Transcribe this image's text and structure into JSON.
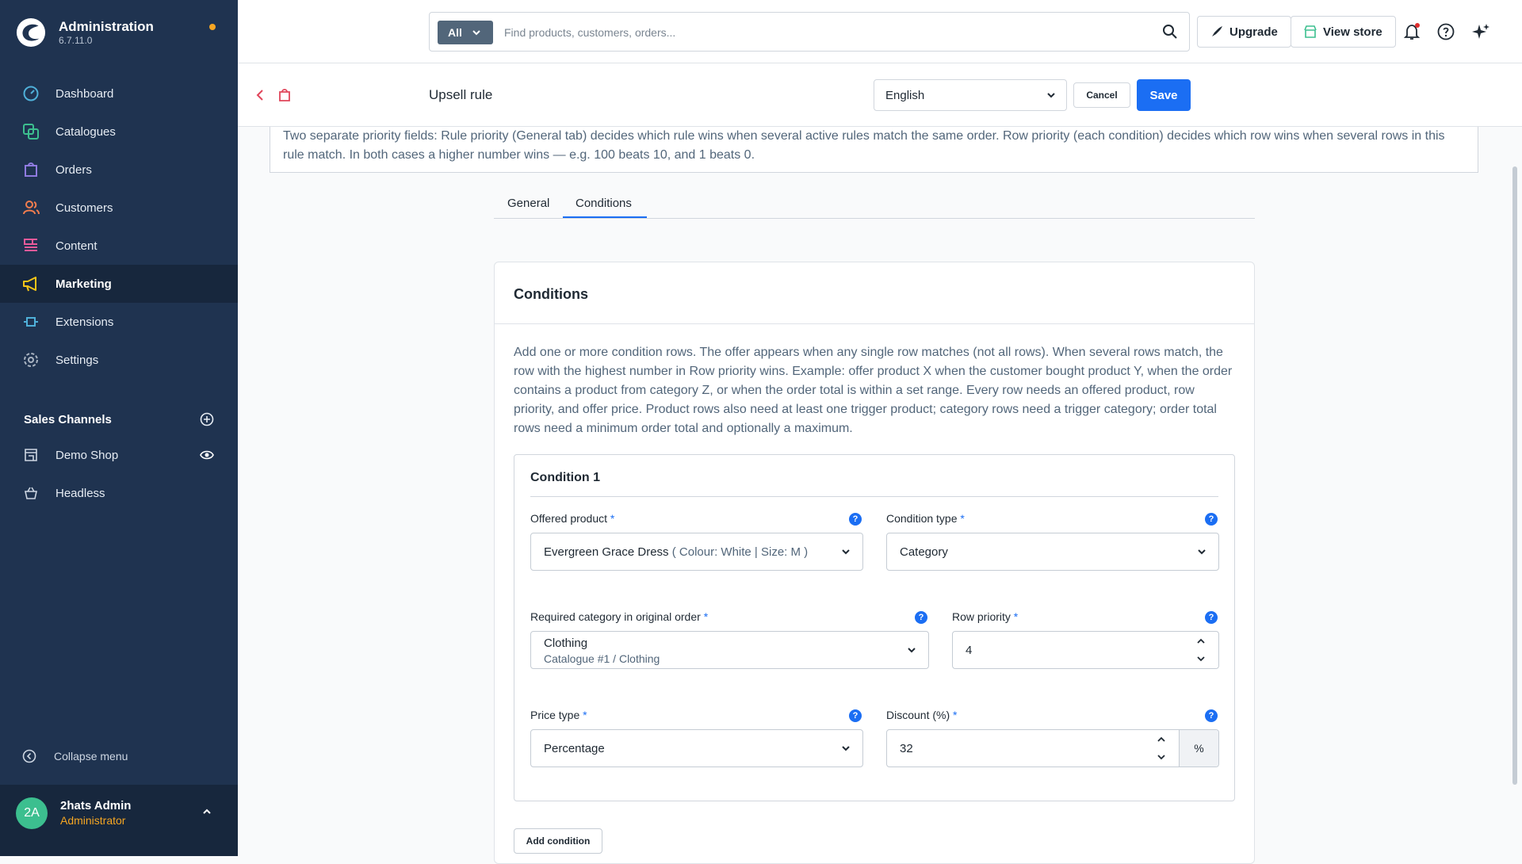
{
  "sidebar": {
    "brand_title": "Administration",
    "brand_version": "6.7.11.0",
    "items": [
      {
        "label": "Dashboard",
        "icon": "dashboard-icon",
        "color": "#4fb0d9"
      },
      {
        "label": "Catalogues",
        "icon": "catalogues-icon",
        "color": "#3cbf8f"
      },
      {
        "label": "Orders",
        "icon": "orders-icon",
        "color": "#8f7be0"
      },
      {
        "label": "Customers",
        "icon": "customers-icon",
        "color": "#f27d4e"
      },
      {
        "label": "Content",
        "icon": "content-icon",
        "color": "#e85a9a"
      },
      {
        "label": "Marketing",
        "icon": "marketing-icon",
        "color": "#f5c518"
      },
      {
        "label": "Extensions",
        "icon": "extensions-icon",
        "color": "#4fb0d9"
      },
      {
        "label": "Settings",
        "icon": "settings-icon",
        "color": "#a8b3c1"
      }
    ],
    "sales_channels_title": "Sales Channels",
    "sales_channels": [
      {
        "label": "Demo Shop"
      },
      {
        "label": "Headless"
      }
    ],
    "collapse_label": "Collapse menu",
    "user": {
      "initials": "2A",
      "name": "2hats Admin",
      "role": "Administrator"
    }
  },
  "topbar": {
    "search_type": "All",
    "search_placeholder": "Find products, customers, orders...",
    "upgrade_label": "Upgrade",
    "view_store_label": "View store"
  },
  "header": {
    "title": "Upsell rule",
    "language": "English",
    "cancel_label": "Cancel",
    "save_label": "Save"
  },
  "info_text": "Two separate priority fields: Rule priority (General tab) decides which rule wins when several active rules match the same order. Row priority (each condition) decides which row wins when several rows in this rule match. In both cases a higher number wins — e.g. 100 beats 10, and 1 beats 0.",
  "tabs": [
    {
      "label": "General"
    },
    {
      "label": "Conditions",
      "active": true
    }
  ],
  "conditions_card": {
    "title": "Conditions",
    "description": "Add one or more condition rows. The offer appears when any single row matches (not all rows). When several rows match, the row with the highest number in Row priority wins. Example: offer product X when the customer bought product Y, when the order contains a product from category Z, or when the order total is within a set range. Every row needs an offered product, row priority, and offer price. Product rows also need at least one trigger product; category rows need a trigger category; order total rows need a minimum order total and optionally a maximum.",
    "condition": {
      "title": "Condition 1",
      "offered_product_label": "Offered product",
      "offered_product_value": "Evergreen Grace Dress",
      "offered_product_variant": "( Colour: White | Size: M )",
      "condition_type_label": "Condition type",
      "condition_type_value": "Category",
      "required_category_label": "Required category in original order",
      "required_category_value": "Clothing",
      "required_category_path": "Catalogue #1 / Clothing",
      "row_priority_label": "Row priority",
      "row_priority_value": "4",
      "price_type_label": "Price type",
      "price_type_value": "Percentage",
      "discount_label": "Discount (%)",
      "discount_value": "32",
      "discount_suffix": "%",
      "required_marker": "*",
      "help_marker": "?"
    },
    "add_condition_label": "Add condition"
  }
}
